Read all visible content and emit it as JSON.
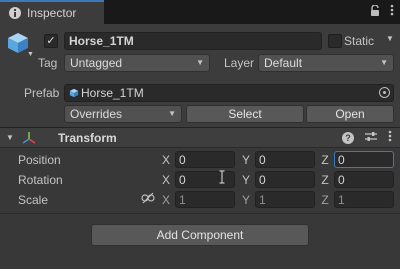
{
  "tab": {
    "title": "Inspector"
  },
  "gameobject": {
    "name": "Horse_1TM",
    "static_label": "Static",
    "tag_label": "Tag",
    "tag_value": "Untagged",
    "layer_label": "Layer",
    "layer_value": "Default",
    "prefab_label": "Prefab",
    "prefab_value": "Horse_1TM",
    "overrides_label": "Overrides",
    "select_label": "Select",
    "open_label": "Open"
  },
  "transform": {
    "title": "Transform",
    "rows": [
      {
        "label": "Position",
        "x": "0",
        "y": "0",
        "z": "0"
      },
      {
        "label": "Rotation",
        "x": "0",
        "y": "0",
        "z": "0"
      },
      {
        "label": "Scale",
        "x": "1",
        "y": "1",
        "z": "1"
      }
    ],
    "axis_x": "X",
    "axis_y": "Y",
    "axis_z": "Z"
  },
  "add_component_label": "Add Component",
  "colors": {
    "accent": "#3a79bb",
    "background": "#383838",
    "tab_bar": "#191919",
    "transform_icon_red": "#e0484b",
    "transform_icon_green": "#7fc446",
    "transform_icon_blue": "#4c8ad8"
  }
}
